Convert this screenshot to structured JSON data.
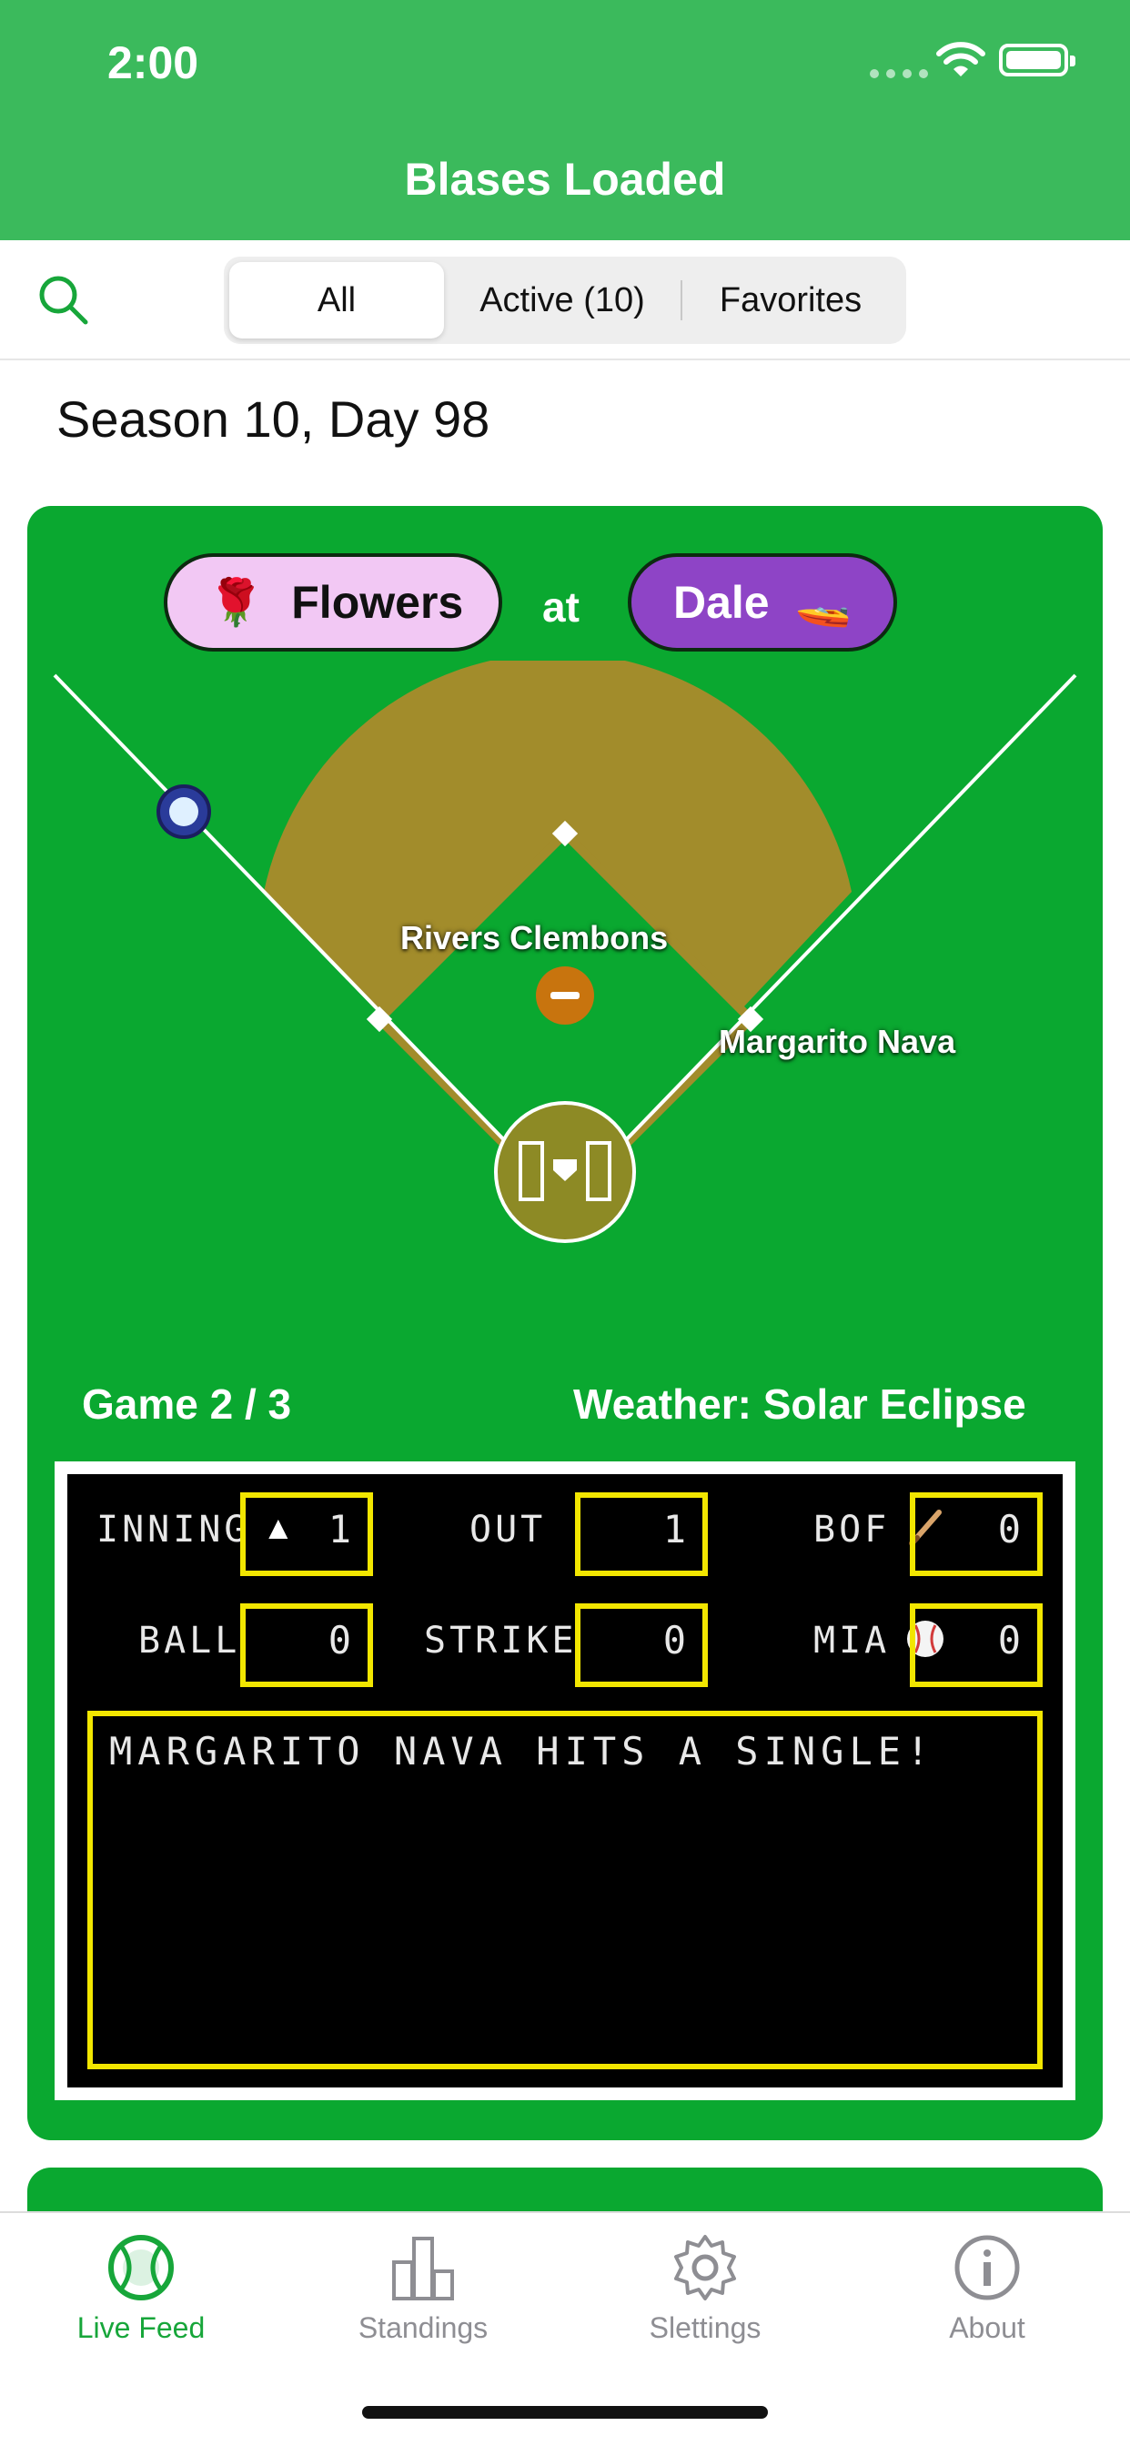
{
  "status_bar": {
    "time": "2:00"
  },
  "header": {
    "title": "Blases Loaded"
  },
  "filter": {
    "segments": [
      {
        "label": "All",
        "selected": true
      },
      {
        "label": "Active (10)",
        "selected": false
      },
      {
        "label": "Favorites",
        "selected": false
      }
    ]
  },
  "day_title": "Season 10, Day 98",
  "game": {
    "away_team": {
      "name": "Flowers",
      "emoji": "🌹",
      "color": "#f2c8f4"
    },
    "at_label": "at",
    "home_team": {
      "name": "Dale",
      "emoji": "🚤",
      "color": "#8e44c6"
    },
    "pitcher": "Rivers Clembons",
    "batter": "Margarito Nava",
    "game_count": "Game 2 / 3",
    "weather": "Weather: Solar Eclipse",
    "scoreboard": {
      "inning_label": "INNING",
      "inning_value": "1",
      "inning_indicator": "▲",
      "out_label": "OUT",
      "out_value": "1",
      "away_abbr": "BOF",
      "away_score": "0",
      "ball_label": "BALL",
      "ball_value": "0",
      "strike_label": "STRIKE",
      "strike_value": "0",
      "home_abbr": "MIA",
      "home_score": "0",
      "last_update": "MARGARITO NAVA HITS A SINGLE!"
    }
  },
  "tabs": [
    {
      "label": "Live Feed",
      "icon": "baseball-icon",
      "selected": true
    },
    {
      "label": "Standings",
      "icon": "bar-chart-icon",
      "selected": false
    },
    {
      "label": "Slettings",
      "icon": "gear-icon",
      "selected": false
    },
    {
      "label": "About",
      "icon": "info-icon",
      "selected": false
    }
  ],
  "colors": {
    "header": "#3bba5c",
    "field_green": "#0aa830",
    "infield_dirt": "#a28c2b",
    "scoreboard_border": "#f2e600",
    "accent": "#17a63a"
  }
}
